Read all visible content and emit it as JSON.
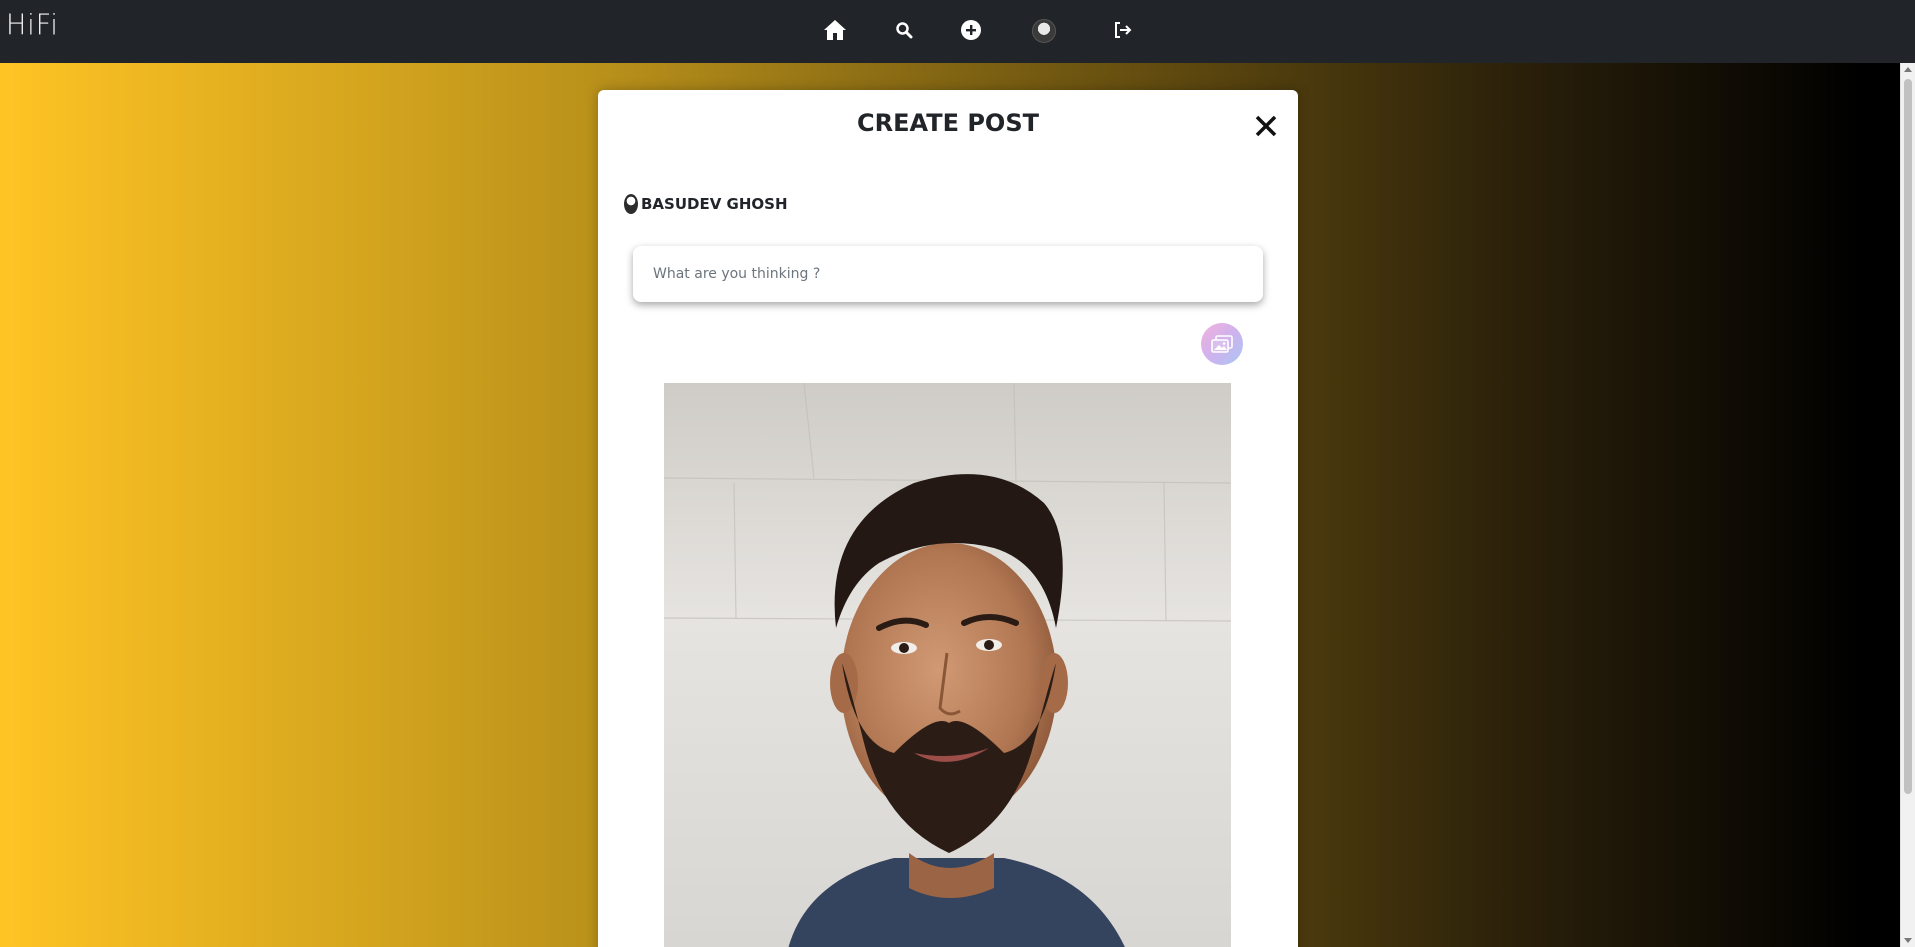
{
  "app": {
    "brand": "HiFi"
  },
  "nav": {
    "icons": [
      "home-icon",
      "search-icon",
      "add-circle-icon",
      "profile-avatar",
      "logout-icon"
    ]
  },
  "modal": {
    "title": "CREATE POST",
    "user": {
      "name": "BASUDEV GHOSH"
    },
    "input": {
      "placeholder": "What are you thinking ?",
      "value": ""
    }
  },
  "colors": {
    "navbar": "#212529",
    "gradient_start": "#ffc424",
    "gradient_end": "#000000",
    "modal_bg": "#ffffff"
  }
}
